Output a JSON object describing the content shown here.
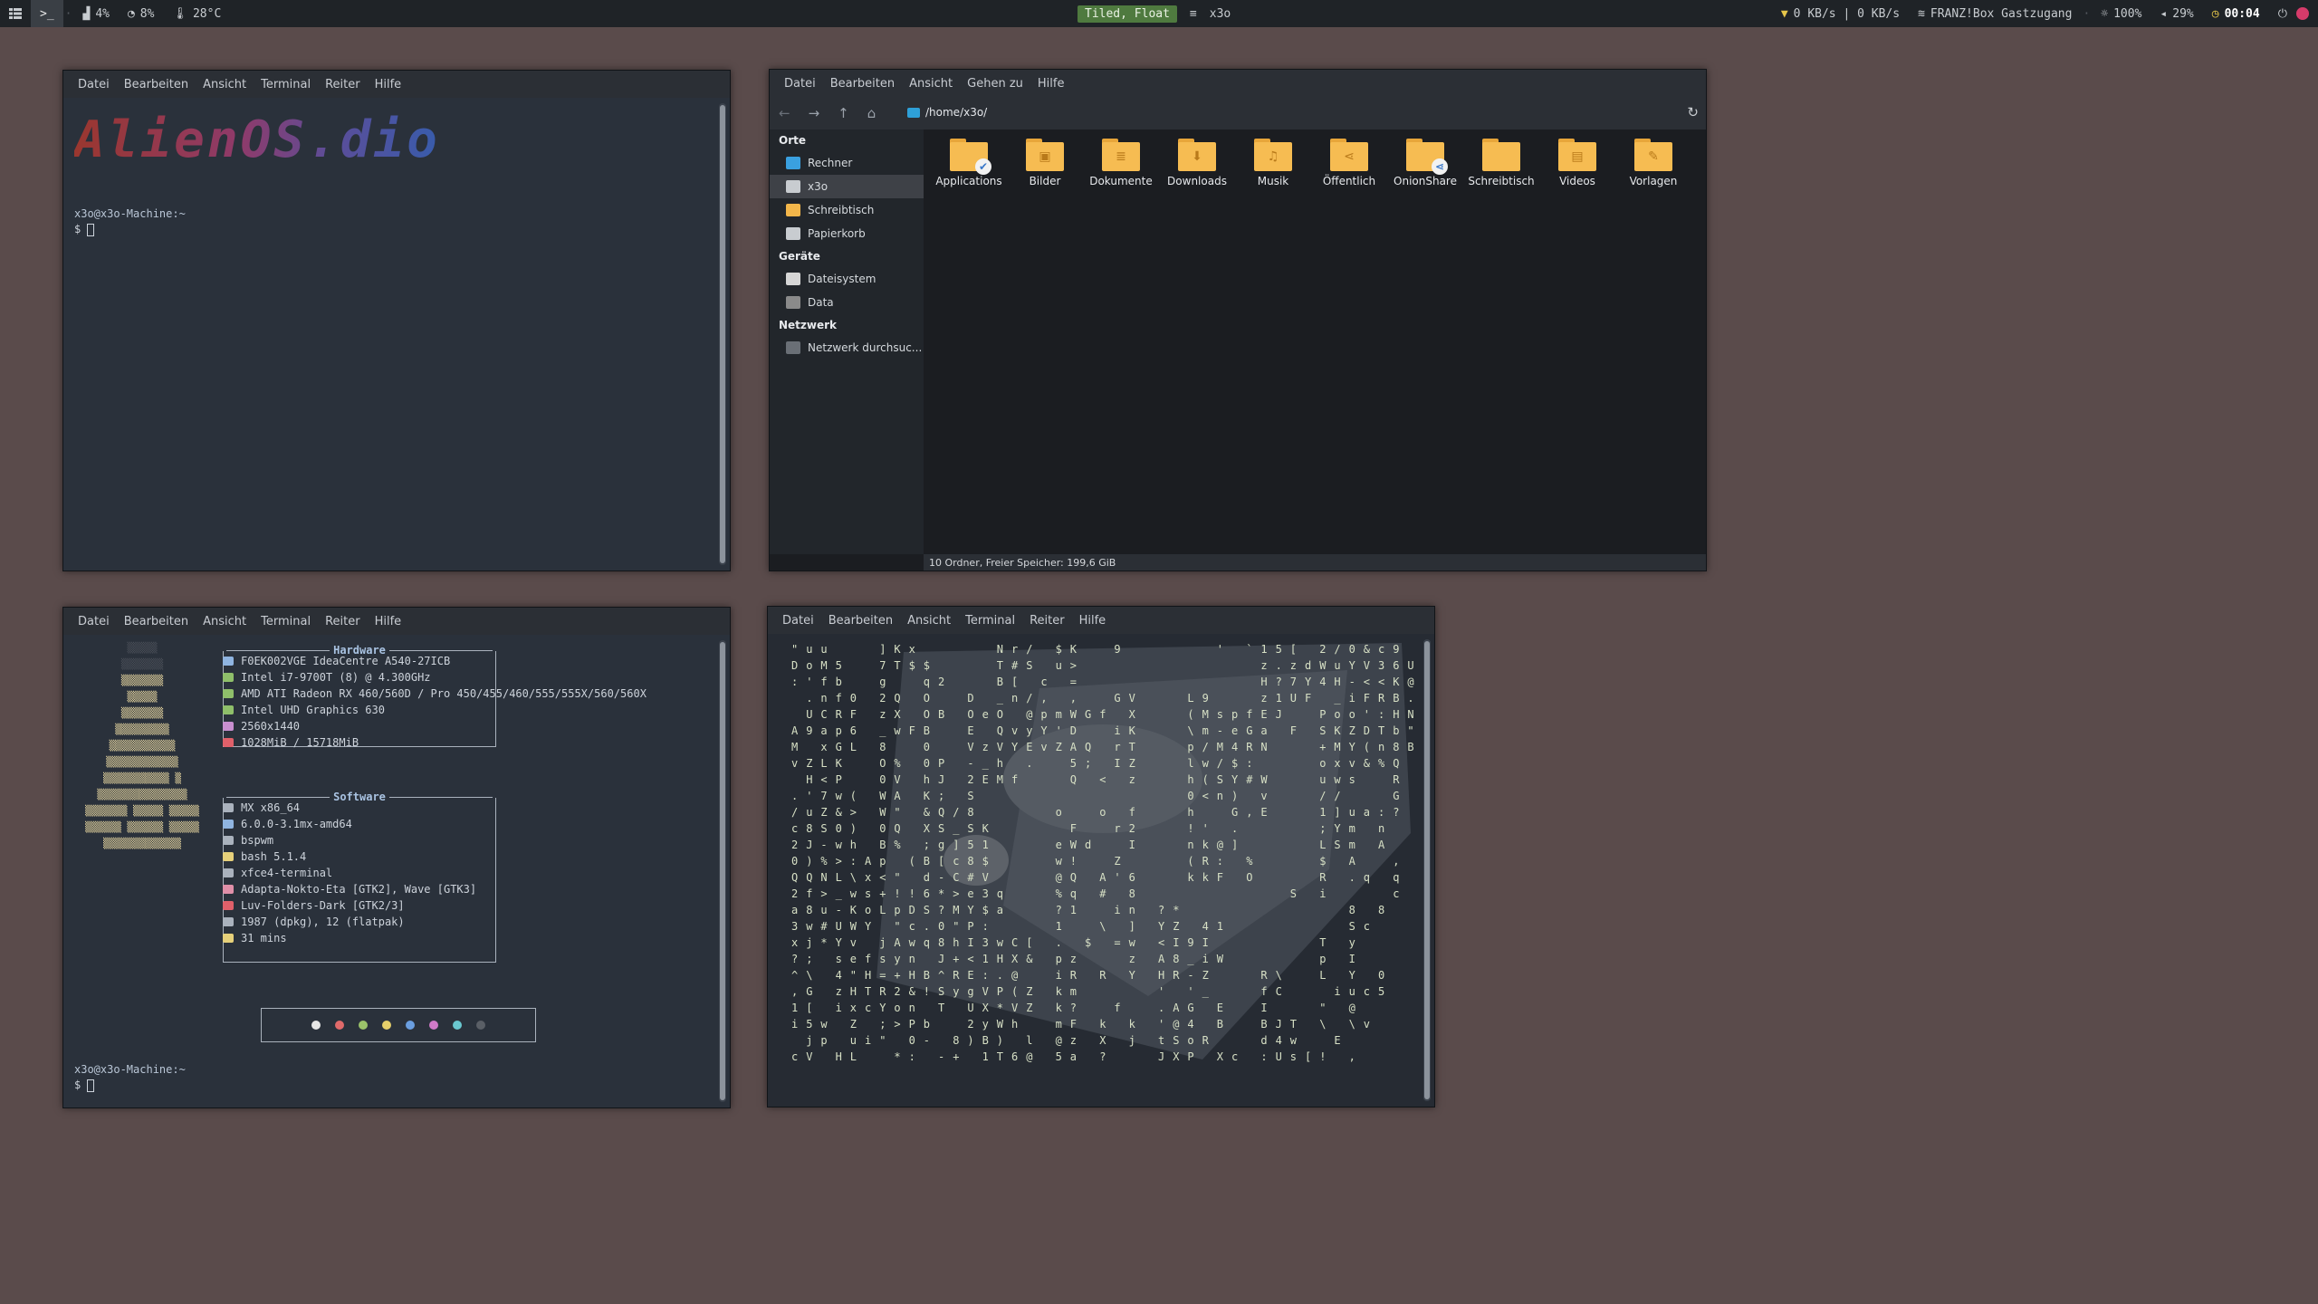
{
  "topbar": {
    "workspace_icon": "grid-icon",
    "active_app": ">_",
    "cpu": "4%",
    "ram": "8%",
    "temp": "28°C",
    "layout": "Tiled, Float",
    "window_title": "x3o",
    "net_speed": "0 KB/s | 0 KB/s",
    "wifi": "FRANZ!Box Gastzugang",
    "brightness": "100%",
    "volume": "29%",
    "clock": "00:04"
  },
  "terminal_menu": [
    "Datei",
    "Bearbeiten",
    "Ansicht",
    "Terminal",
    "Reiter",
    "Hilfe"
  ],
  "term1": {
    "logo": "AlienOS.dio",
    "prompt_host": "x3o@x3o-Machine:~",
    "prompt": "$ "
  },
  "term2": {
    "hardware_title": "Hardware",
    "hardware": [
      {
        "text": "F0EK002VGE IdeaCentre A540-27ICB",
        "color": "#8fb4e0"
      },
      {
        "text": "Intel i7-9700T (8) @ 4.300GHz",
        "color": "#8fbf6a"
      },
      {
        "text": "AMD ATI Radeon RX 460/560D / Pro 450/455/460/555/555X/560/560X",
        "color": "#8fbf6a"
      },
      {
        "text": "Intel UHD Graphics 630",
        "color": "#8fbf6a"
      },
      {
        "text": "2560x1440",
        "color": "#c98fd0"
      },
      {
        "text": "1028MiB / 15718MiB",
        "color": "#e0606a"
      }
    ],
    "software_title": "Software",
    "software": [
      {
        "text": "MX x86_64",
        "color": "#aab2bd"
      },
      {
        "text": "6.0.0-3.1mx-amd64",
        "color": "#8fb4e0"
      },
      {
        "text": "bspwm",
        "color": "#aab2bd"
      },
      {
        "text": "bash 5.1.4",
        "color": "#e6d07a"
      },
      {
        "text": "xfce4-terminal",
        "color": "#aab2bd"
      },
      {
        "text": "Adapta-Nokto-Eta [GTK2], Wave [GTK3]",
        "color": "#e08fa8"
      },
      {
        "text": "Luv-Folders-Dark [GTK2/3]",
        "color": "#e0606a"
      },
      {
        "text": "1987 (dpkg), 12 (flatpak)",
        "color": "#aab2bd"
      },
      {
        "text": "31 mins",
        "color": "#e6d07a"
      }
    ],
    "palette": [
      "#e6e6e6",
      "#e06a6a",
      "#9bc36a",
      "#e6cf6a",
      "#6a9ee0",
      "#d07ac8",
      "#6ac8d0",
      "#5a5f66"
    ],
    "prompt_host": "x3o@x3o-Machine:~",
    "prompt": "$ "
  },
  "matrix_columns": [
    "\"\nD\n:\n \n \nA\nM\nv\n \n.\n/\nc\n2\n0\nQ\n2\na\n3\nx\n?\n^\n,\n1\ni\n \nc",
    "u\no\n'\n.\nU\n9\n \nZ\nH\n'\nu\n8\nJ\n)\nQ\nf\n8\nw\nj\n;\n\\\nG\n[\n5\nj\nV",
    "u\nM\nf\nn\nC\na\nx\nL\n<\n7\nZ\nS\n-\n%\nN\n>\nu\n#\n*\n \n \n \n \nw\np\n ",
    " \n5\nb\nf\nR\np\nG\nK\nP\nw\n&\n0\nw\n>\nL\n_\n-\nU\nY\ns\n4\nz\ni\n \n \nH",
    " \n \n \n0\nF\n6\nL\n \n \n(\n>\n)\nh\n:\n\\\nw\nK\nW\nv\ne\n\"\nH\nx\nZ\nu\nL",
    " \n \n \n \n \n \n \n \n \n \n \n \n \nA\nx\ns\no\nY\n \nf\nH\nT\nc\n \ni\n ",
    "]\n7\ng\n2\nz\n_\n8\nO\n0\nW\nW\n0\nB\np\n<\n+\nL\n \nj\ns\n=\nR\nY\n;\n\"\n ",
    "K\nT\n \nQ\nX\nw\n \n%\nV\nA\n\"\nQ\n%\n \n\"\n!\np\n\"\nA\ny\n+\n2\no\n>\n \n*",
    "x\n$\n \n \n \nF\n \n \n \n \n \n \n \n(\n \n!\nD\nc\nw\nn\nH\n&\nn\nP\n0\n:",
    " \n$\nq\nO\nO\nB\n0\n0\nh\nK\n&\nX\n;\nB\nd\n6\nS\n.\nq\n \nB\n!\n \nb\n-\n ",
    " \n \n2\n \nB\n \n \nP\nJ\n;\nQ\nS\ng\n[\n-\n*\n?\n0\n8\nJ\n^\nS\nT\n \n \n-",
    " \n \n \n \n \n \n \n \n \n \n/\n_\n]\nc\nC\n>\nM\n\"\nh\n+\nR\ny\n \n \n8\n+",
    " \n \n \nD\nO\nE\nV\n-\n2\nS\n8\nS\n5\n8\n#\ne\nY\nP\nI\n<\nE\ng\nU\n2\n)\n ",
    " \n \n \n \ne\n \nz\n_\nE\n \n \nK\n1\n$\nV\n3\n$\n:\n3\n1\n:\nV\nX\ny\nB\n1",
    "N\nT\nB\n_\nO\nQ\nV\nh\nM\n \n \n \n \n \n \nq\na\n \nw\nH\n.\nP\n*\nW\n)\nT",
    "r\n#\n[\nn\n \nv\nY\n \nf\n \n \n \n \n \n \n \n \n \nC\nX\n@\n(\nV\nh\n \n6",
    "/\nS\n \n/\n@\ny\nE\n.\n \n \n \n \n \n \n \n \n \n \n[\n&\n \nZ\nZ\n \nl\n@",
    " \n \nc\n,\np\nY\nv\n \n \n \n \n \n \n \n \n \n \n \n \n \n \n \n \n \n \n ",
    "$\nu\n \n \nm\n'\nZ\n \n \n \no\n \ne\nw\n@\n%\n?\n1\n.\np\ni\nk\nk\nm\n@\n5",
    "K\n>\n=\n,\nW\nD\nA\n5\nQ\n \n \nF\nW\n!\nQ\nq\n1\n \n \nz\nR\nm\n?\nF\nz\na",
    " \n \n \n \nG\n \nQ\n;\n \n \n \n \nd\n \n \n \n \n \n$\n \n \n \n \n \n \n ",
    " \n \n \n \nf\n \n \n \n<\n \no\n \n \n \nA\n#\n \n\\\n \n \nR\n \n \nk\nX\n?",
    "9\n \n \nG\n \ni\nr\nI\n \n \n \nr\n \nZ\n'\n \ni\n \n=\n \n \n \nf\n \n \n ",
    " \n \n \nV\nX\nK\nT\nZ\nz\n \nf\n2\nI\n \n6\n8\nn\n]\nw\nz\nY\n \n \nk\nj\n ",
    " \n \n \n \n \n \n \n \n \n \n \n \n \n \n \n \n \n \n \n \n \n \n \n \n \n ",
    " \n \n \n \n \n \n \n \n \n \n \n \n \n \n \n \n?\nY\n<\nA\nH\n'\n.\n'\nt\nJ",
    " \n \n \n \n \n \n \n \n \n \n \n \n \n \n \n \n*\nZ\nI\n8\nR\n \nA\n@\nS\nX",
    " \n \n \nL\n(\n\\\np\nl\nh\n0\nh\n!\nn\n(\nk\n \n \n \n9\n_\n-\n'\nG\n4\no\nP",
    " \n \n \n9\nM\nm\n/\nw\n(\n<\n \n'\nk\nR\nk\n \n \n4\nI\ni\nZ\n_\n \n \nR\n ",
    "'\n \n \n \ns\n-\nM\n/\nS\nn\n \n \n@\n:\nF\n \n \n1\n \nW\n \n \nE\nB\n \nX",
    " \n \n \n \np\ne\n4\n$\nY\n)\nG\n.\n]\n \n \n \n \n \n \n \n \n \n \n \n \nc",
    "`\n \n \n \nf\nG\nR\n:\n#\n \n,\n \n \n%\nO\n \n \n \n \n \n \n \n \n \n \n ",
    "1\nz\nH\nz\nE\na\nN\n \nW\nv\nE\n \n \n \n \n \n \n \n \n \nR\nf\nI\nB\nd\n:",
    "5\n.\n?\n1\nJ\n \n \n \n \n \n \n \n \n \n \n \n \n \n \n \n\\\nC\n \nJ\n4\nU",
    "[\nz\n7\nU\n \nF\n \n \n \n \n \n \n \n \n \nS\n \n \n \n \n \n \n \nT\nw\ns",
    " \nd\nY\nF\n \n \n \n \n \n \n \n \n \n \n \n \n \n \n \n \n \n \n \n \n \n[",
    "2\nW\n4\n \nP\nS\n+\no\nu\n/\n1\n;\nL\n$\nR\ni\n \n \nT\np\nL\n \n\"\n\\\n \n!",
    "/\nu\nH\n_\no\nK\nM\nx\nw\n/\n]\nY\nS\n \n \n \n \n \n \n \n \ni\n \n \nE\n ",
    "0\nY\n-\ni\no\nZ\nY\nv\ns\n \nu\nm\nm\nA\n.\n \n8\nS\ny\nI\nY\nu\n@\n\\\n \n,",
    "&\nV\n<\nF\n'\nD\n(\n&\n \n \na\n \n \n \nq\n \n \nc\n \n \n \nc\n \nv\n \n ",
    "c\n3\n<\nR\n:\nT\nn\n%\n \n \n:\nn\nA\n \n \n \n8\n \n \n \n0\n5\n \n \n \n ",
    "9\n6\nK\nB\nH\nb\n8\nQ\nR\nG\n?\n \n \n,\nq\nc\n \n \n \n \n \n \n \n \n \n ",
    "\nU\n@\n.\nN\n\"\nB\n \n \n \n \n \n \n \n \n \n \n \n \n \n \n \n \n \n \n "
  ],
  "file_manager": {
    "menu": [
      "Datei",
      "Bearbeiten",
      "Ansicht",
      "Gehen zu",
      "Hilfe"
    ],
    "path": "/home/x3o/",
    "sidebar": [
      {
        "type": "header",
        "label": "Orte"
      },
      {
        "type": "item",
        "label": "Rechner",
        "icon": "computer-icon",
        "color": "#3aa0e0"
      },
      {
        "type": "item",
        "label": "x3o",
        "icon": "home-icon",
        "color": "#c8ccd0",
        "selected": true
      },
      {
        "type": "item",
        "label": "Schreibtisch",
        "icon": "desktop-folder-icon",
        "color": "#f3b64a"
      },
      {
        "type": "item",
        "label": "Papierkorb",
        "icon": "trash-icon",
        "color": "#c8ccd0"
      },
      {
        "type": "header",
        "label": "Geräte"
      },
      {
        "type": "item",
        "label": "Dateisystem",
        "icon": "drive-icon",
        "color": "#d6d6d6"
      },
      {
        "type": "item",
        "label": "Data",
        "icon": "drive-icon",
        "color": "#8a8a8a"
      },
      {
        "type": "header",
        "label": "Netzwerk"
      },
      {
        "type": "item",
        "label": "Netzwerk durchsuc...",
        "icon": "network-icon",
        "color": "#6a6f76"
      }
    ],
    "folders": [
      {
        "label": "Applications",
        "emblem": "✔"
      },
      {
        "label": "Bilder",
        "glyph": "▣"
      },
      {
        "label": "Dokumente",
        "glyph": "≣"
      },
      {
        "label": "Downloads",
        "glyph": "⬇"
      },
      {
        "label": "Musik",
        "glyph": "♫"
      },
      {
        "label": "Öffentlich",
        "glyph": "⋖"
      },
      {
        "label": "OnionShare",
        "emblem": "⋖"
      },
      {
        "label": "Schreibtisch",
        "glyph": ""
      },
      {
        "label": "Videos",
        "glyph": "▤"
      },
      {
        "label": "Vorlagen",
        "glyph": "✎"
      }
    ],
    "status": "10 Ordner, Freier Speicher: 199,6 GiB"
  }
}
